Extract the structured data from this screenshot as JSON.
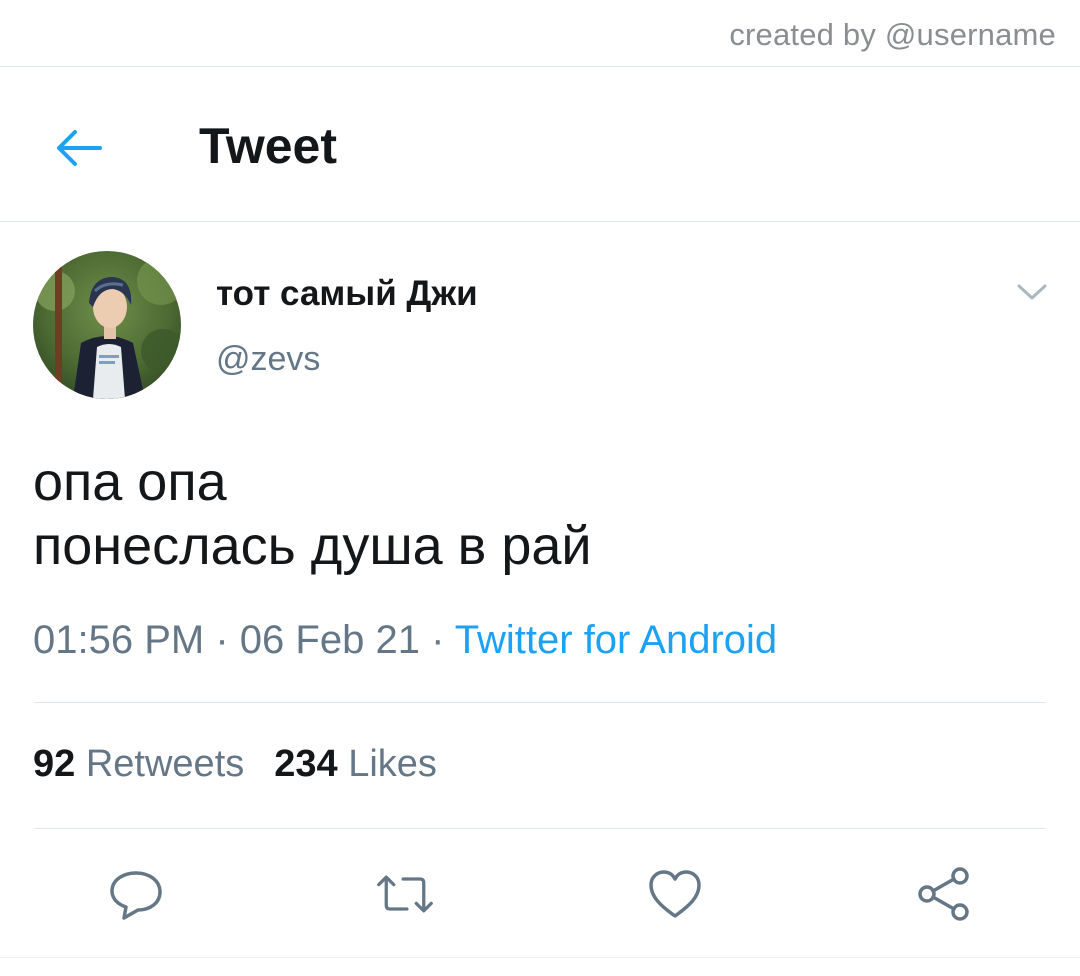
{
  "credit": "created by @username",
  "header": {
    "title": "Tweet"
  },
  "tweet": {
    "author_name": "тот самый Джи",
    "author_handle": "@zevs",
    "text_lines": [
      "опа опа",
      "понеслась душа в рай"
    ],
    "time": "01:56 PM",
    "separator": "·",
    "date": "06 Feb 21",
    "source": "Twitter for Android"
  },
  "stats": {
    "retweets_count": "92",
    "retweets_label": "Retweets",
    "likes_count": "234",
    "likes_label": "Likes"
  },
  "icons": {
    "back": "arrow-left-icon",
    "more": "chevron-down-icon",
    "reply": "reply-icon",
    "retweet": "retweet-icon",
    "like": "heart-icon",
    "share": "share-icon"
  },
  "colors": {
    "accent": "#1da1f2",
    "text_primary": "#14171a",
    "text_secondary": "#657786",
    "divider": "#e1e8ed"
  }
}
